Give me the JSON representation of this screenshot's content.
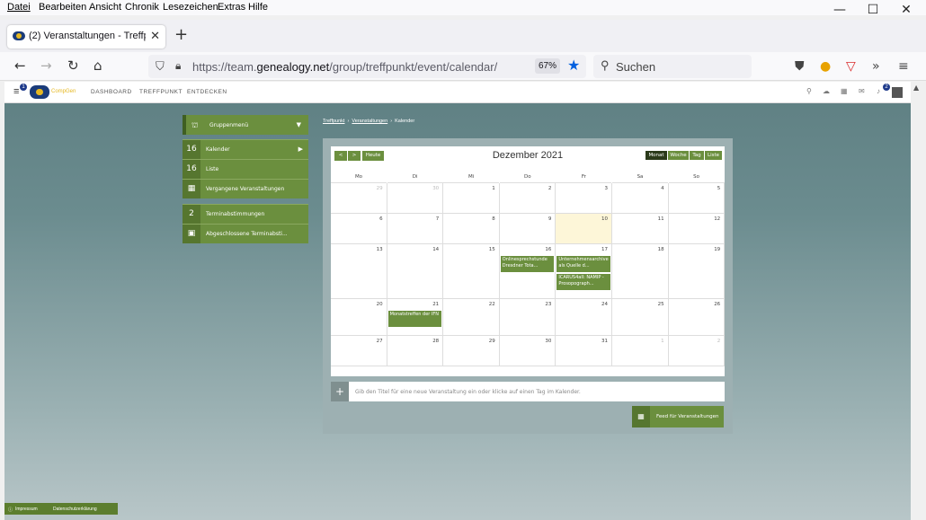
{
  "menubar": [
    "Datei",
    "Bearbeiten",
    "Ansicht",
    "Chronik",
    "Lesezeichen",
    "Extras",
    "Hilfe"
  ],
  "window_controls": {
    "minimize": "—",
    "maximize": "☐",
    "close": "✕"
  },
  "tab": {
    "title": "(2) Veranstaltungen - Treffpunkt",
    "close": "✕"
  },
  "newtab": "+",
  "url": {
    "prefix": "https://team.",
    "host": "genealogy.net",
    "path": "/group/treffpunkt/event/calendar/"
  },
  "zoom": "67%",
  "search_placeholder": "Suchen",
  "site": {
    "logo_text": "CompGen",
    "nav": [
      "DASHBOARD",
      "TREFFPUNKT",
      "ENTDECKEN"
    ],
    "notif_badge": "1",
    "bell_badge": "2"
  },
  "sidebar": {
    "group_menu": "Gruppenmenü",
    "items": [
      {
        "num": "16",
        "label": "Kalender"
      },
      {
        "num": "16",
        "label": "Liste"
      },
      {
        "num": "",
        "label": "Vergangene Veranstaltungen"
      },
      {
        "num": "2",
        "label": "Terminabstimmungen"
      },
      {
        "num": "",
        "label": "Abgeschlossene Terminabsti..."
      }
    ]
  },
  "breadcrumb": [
    "Treffpunkt",
    "Veranstaltungen",
    "Kalender"
  ],
  "calendar": {
    "title": "Dezember 2021",
    "today_button": "Heute",
    "prev": "<",
    "next": ">",
    "views": [
      "Monat",
      "Woche",
      "Tag",
      "Liste"
    ],
    "active_view": "Monat",
    "weekdays": [
      "Mo",
      "Di",
      "Mi",
      "Do",
      "Fr",
      "Sa",
      "So"
    ],
    "weeks": [
      [
        "29",
        "30",
        "1",
        "2",
        "3",
        "4",
        "5"
      ],
      [
        "6",
        "7",
        "8",
        "9",
        "10",
        "11",
        "12"
      ],
      [
        "13",
        "14",
        "15",
        "16",
        "17",
        "18",
        "19"
      ],
      [
        "20",
        "21",
        "22",
        "23",
        "24",
        "25",
        "26"
      ],
      [
        "27",
        "28",
        "29",
        "30",
        "31",
        "1",
        "2"
      ]
    ],
    "events": [
      {
        "label": "Onlinesprechstunde Dresdner Tota...",
        "week": 2,
        "day": 3,
        "slot": 0
      },
      {
        "label": "Unternehmensarchive als Quelle d...",
        "week": 2,
        "day": 4,
        "slot": 0
      },
      {
        "label": "ICARUS4all: NAMIP - Prosopograph...",
        "week": 2,
        "day": 4,
        "slot": 1
      },
      {
        "label": "Monatstreffen der IFN",
        "week": 3,
        "day": 1,
        "slot": 0
      }
    ]
  },
  "new_event_placeholder": "Gib den Titel für eine neue Veranstaltung ein oder klicke auf einen Tag im Kalender.",
  "feed_button": "Feed für Veranstaltungen",
  "footer": {
    "impressum": "Impressum",
    "privacy": "Datenschutzerklärung"
  }
}
